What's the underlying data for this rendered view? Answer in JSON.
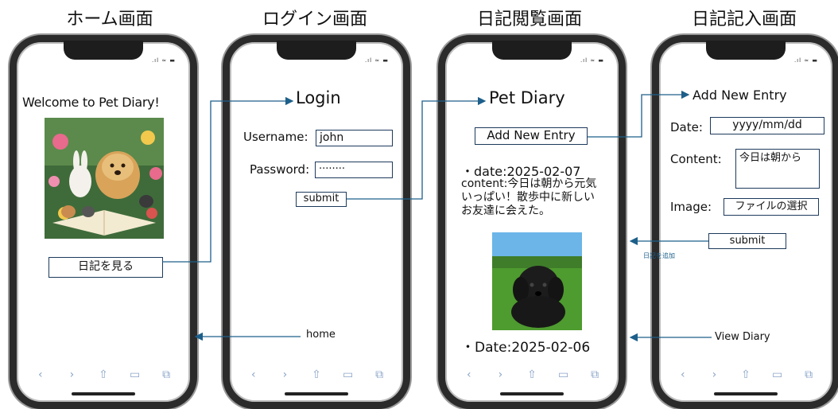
{
  "titles": {
    "home": "ホーム画面",
    "login": "ログイン画面",
    "diary_view": "日記閲覧画面",
    "diary_entry": "日記記入画面"
  },
  "home_screen": {
    "welcome": "Welcome to Pet Diary!",
    "view_diary_button": "日記を見る"
  },
  "login_screen": {
    "title": "Login",
    "username_label": "Username:",
    "username_value": "john",
    "password_label": "Password:",
    "password_value": "········",
    "submit_button": "submit"
  },
  "diary_view_screen": {
    "title": "Pet Diary",
    "add_entry_button": "Add New Entry",
    "entry1_date": "・date:2025-02-07",
    "entry1_content": "content:今日は朝から元気いっぱい！散歩中に新しいお友達に会えた。",
    "entry2_date": "・Date:2025-02-06"
  },
  "entry_screen": {
    "title": "Add New Entry",
    "date_label": "Date:",
    "date_placeholder": "yyyy/mm/dd",
    "content_label": "Content:",
    "content_value": "今日は朝から",
    "image_label": "Image:",
    "image_button": "ファイルの選択",
    "submit_button": "submit"
  },
  "flow_labels": {
    "add_to_diary": "日記を追加",
    "home": "home",
    "view_diary": "View Diary"
  },
  "icons": [
    "back-icon",
    "forward-icon",
    "share-icon",
    "bookmarks-icon",
    "tabs-icon"
  ],
  "colors": {
    "arrow": "#1d5f8a",
    "box_border": "#1d3a5c",
    "phone_frame": "#2b2b2b",
    "toolbar_icon": "#8aa4c8"
  }
}
